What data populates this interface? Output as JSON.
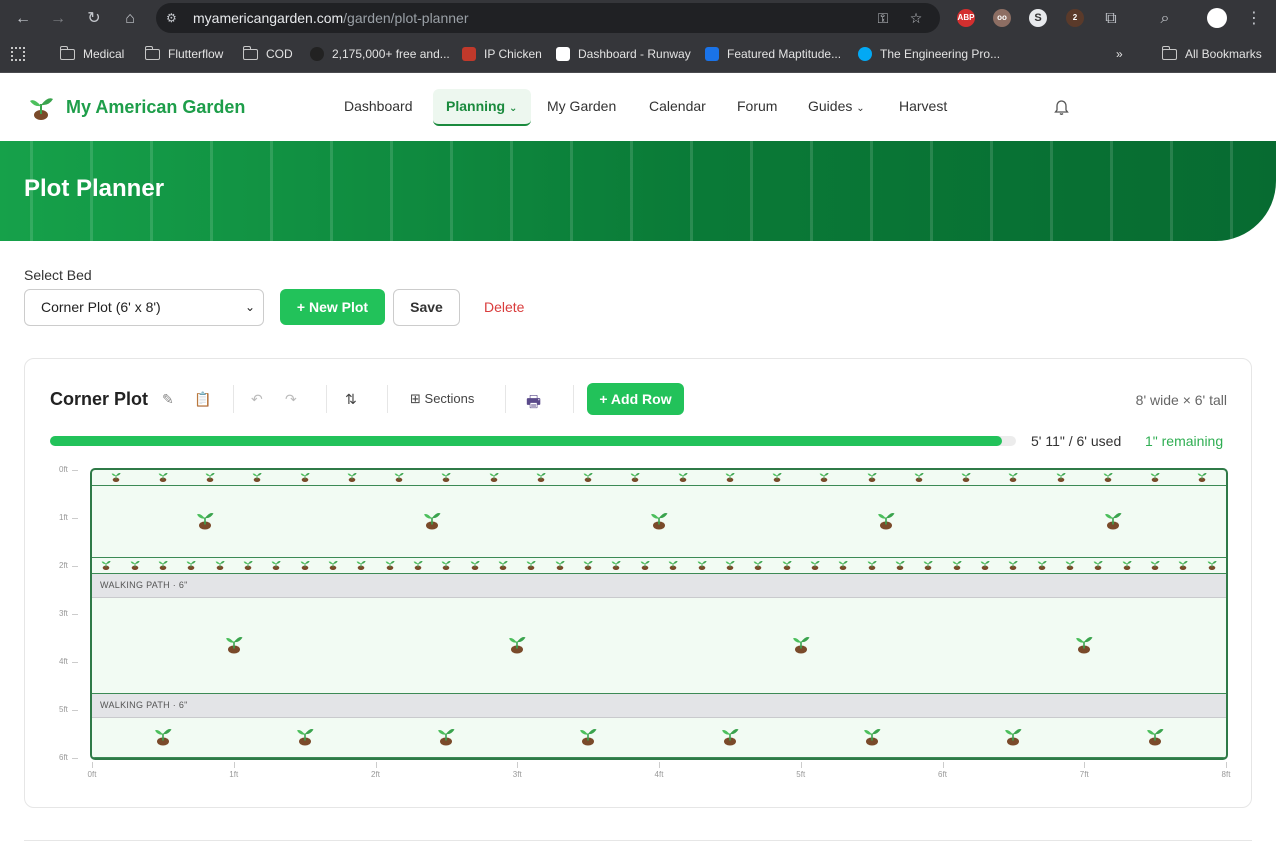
{
  "browser": {
    "url_host": "myamericangarden.com",
    "url_path": "/garden/plot-planner",
    "bookmarks": [
      "Medical",
      "Flutterflow",
      "COD",
      "2,175,000+ free and...",
      "IP Chicken",
      "Dashboard - Runway",
      "Featured Maptitude...",
      "The Engineering Pro...",
      "All Bookmarks"
    ]
  },
  "header": {
    "brand": "My American Garden",
    "nav": [
      "Dashboard",
      "Planning",
      "My Garden",
      "Calendar",
      "Forum",
      "Guides",
      "Harvest"
    ],
    "active": "Planning"
  },
  "hero": {
    "title": "Plot Planner"
  },
  "controls": {
    "select_label": "Select Bed",
    "selected_bed": "Corner Plot (6' x 8')",
    "new_plot": "+ New Plot",
    "save": "Save",
    "delete": "Delete"
  },
  "plot": {
    "title": "Corner Plot",
    "sections_label": "Sections",
    "add_row": "+ Add Row",
    "dimensions": "8' wide × 6' tall",
    "used": "5' 11\" / 6' used",
    "remaining": "1\" remaining",
    "used_fraction": 0.986,
    "walking_path_label": "WALKING PATH · 6\"",
    "y_labels": [
      "0ft",
      "1ft",
      "2ft",
      "3ft",
      "4ft",
      "5ft",
      "6ft"
    ],
    "x_labels": [
      "0ft",
      "1ft",
      "2ft",
      "3ft",
      "4ft",
      "5ft",
      "6ft",
      "7ft",
      "8ft"
    ],
    "rows": [
      {
        "type": "plants",
        "plants": 24,
        "size": "small"
      },
      {
        "type": "plants",
        "plants": 5,
        "size": "large"
      },
      {
        "type": "plants",
        "plants": 40,
        "size": "small"
      },
      {
        "type": "path"
      },
      {
        "type": "plants",
        "plants": 4,
        "size": "large"
      },
      {
        "type": "path"
      },
      {
        "type": "plants",
        "plants": 8,
        "size": "large"
      }
    ]
  }
}
